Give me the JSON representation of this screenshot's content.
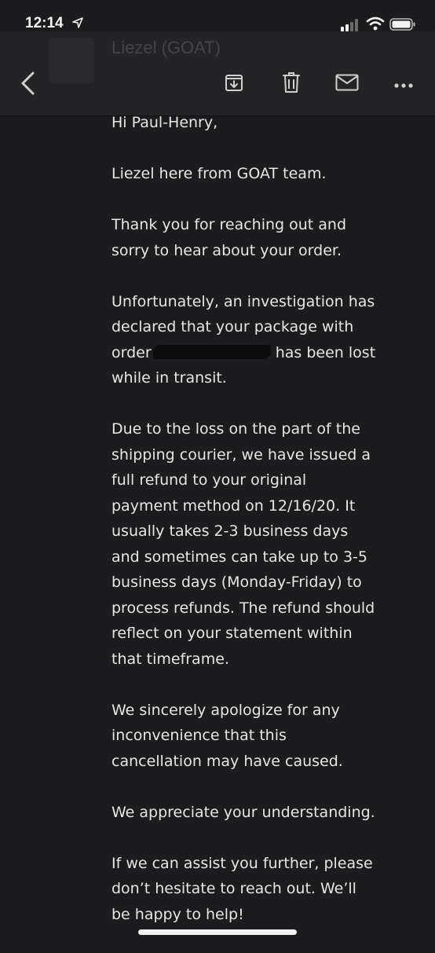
{
  "status": {
    "time": "12:14"
  },
  "header": {
    "sender_name": "Liezel (GOAT)",
    "sender_subtitle": ""
  },
  "toolbar": {
    "back_icon": "chevron-left-icon",
    "archive_icon": "archive-icon",
    "delete_icon": "trash-icon",
    "mark_unread_icon": "envelope-icon",
    "more_icon": "more-icon"
  },
  "email": {
    "greeting": "Hi Paul-Henry,",
    "p1": "Liezel here from GOAT team.",
    "p2": "Thank you for reaching out and\nsorry to hear about your order.",
    "p3_before": "Unfortunately, an investigation has\ndeclared that your package with\norder ",
    "p3_after": " has been lost\nwhile in transit.",
    "p4": "Due to the loss on the part of the\nshipping courier, we have issued a\nfull refund to your original\npayment method on 12/16/20. It\nusually takes 2-3 business days\nand sometimes can take up to 3-5\nbusiness days (Monday-Friday) to\nprocess refunds. The refund should\nreflect on your statement within\nthat timeframe.",
    "p5": "We sincerely apologize for any\ninconvenience that this\ncancellation may have caused.",
    "p6": "We appreciate your understanding.",
    "p7": "If we can assist you further, please\ndon’t hesitate to reach out. We’ll\nbe happy to help!"
  },
  "colors": {
    "background": "#1c1c1e",
    "header": "#242426",
    "text": "#e6e6e6",
    "icon": "#d0d0d0"
  }
}
